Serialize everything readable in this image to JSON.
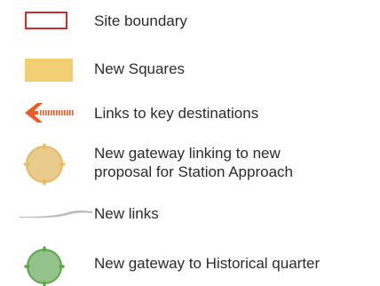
{
  "legend": {
    "items": [
      {
        "symbol": "site-boundary-symbol",
        "label": "Site boundary"
      },
      {
        "symbol": "new-squares-symbol",
        "label": "New Squares"
      },
      {
        "symbol": "key-destination-arrow-icon",
        "label": "Links to key destinations"
      },
      {
        "symbol": "station-gateway-symbol",
        "label_line1": "New gateway linking to new",
        "label_line2": "proposal for Station Approach"
      },
      {
        "symbol": "new-links-symbol",
        "label": "New links"
      },
      {
        "symbol": "historical-gateway-symbol",
        "label": "New gateway to Historical quarter"
      }
    ]
  },
  "colors": {
    "boundary": "#d7282f",
    "squares": "#f1cf72",
    "arrow": "#ef5a24",
    "station_gateway_fill": "#eacb8e",
    "station_gateway_stroke": "#e8b85d",
    "links": "#bdbdbd",
    "historical_gateway_fill": "#93c28b",
    "historical_gateway_stroke": "#5aa946"
  }
}
